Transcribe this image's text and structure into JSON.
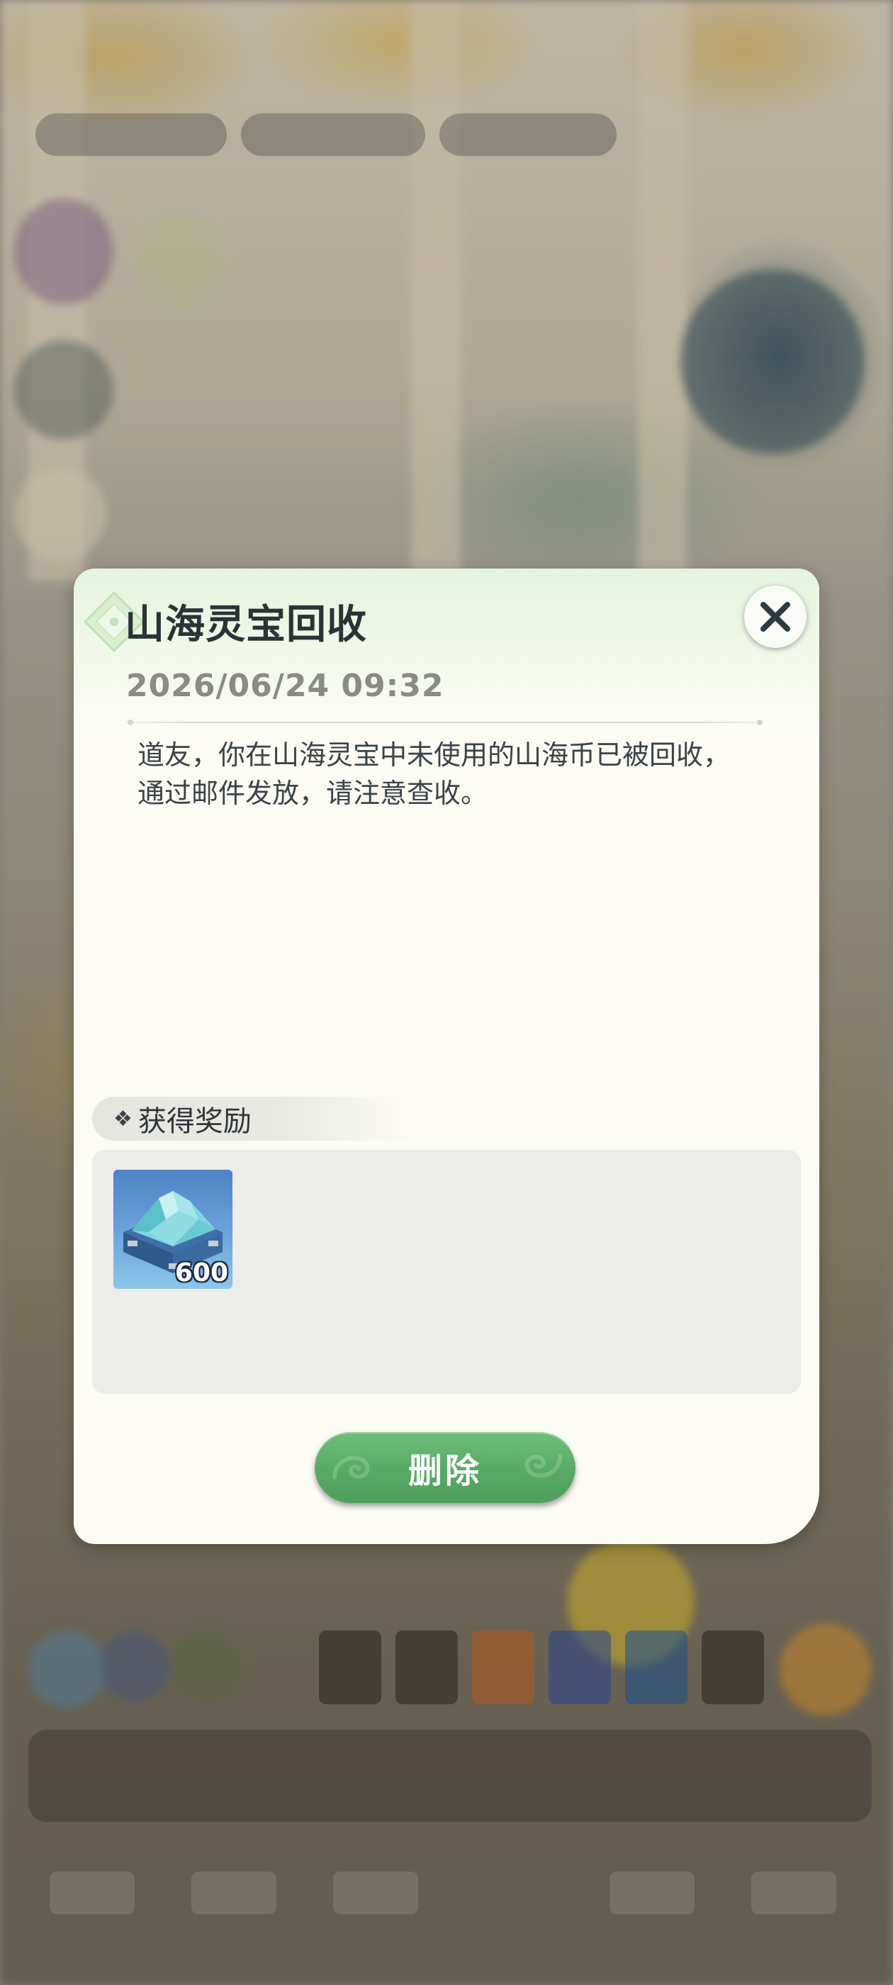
{
  "dialog": {
    "title": "山海灵宝回收",
    "date": "2026/06/24 09:32",
    "message_lines": [
      "道友，你在山海灵宝中未使用的山海币已被回收，",
      "通过邮件发放，请注意查收。"
    ],
    "close_icon": "close-icon",
    "rewards": {
      "title": "获得奖励",
      "header_icon": "diamond-sparkle-icon",
      "items": [
        {
          "icon": "shanhai-coin-crystal-icon",
          "quantity": "600"
        }
      ]
    },
    "delete_button": {
      "label": "删除"
    }
  },
  "colors": {
    "dialog_bg": "#fcfcf4",
    "title_text": "#2b3336",
    "date_text": "#8a8a86",
    "body_text": "#3b4348",
    "delete_button": "#58ab66",
    "rewards_panel": "#ececea"
  }
}
